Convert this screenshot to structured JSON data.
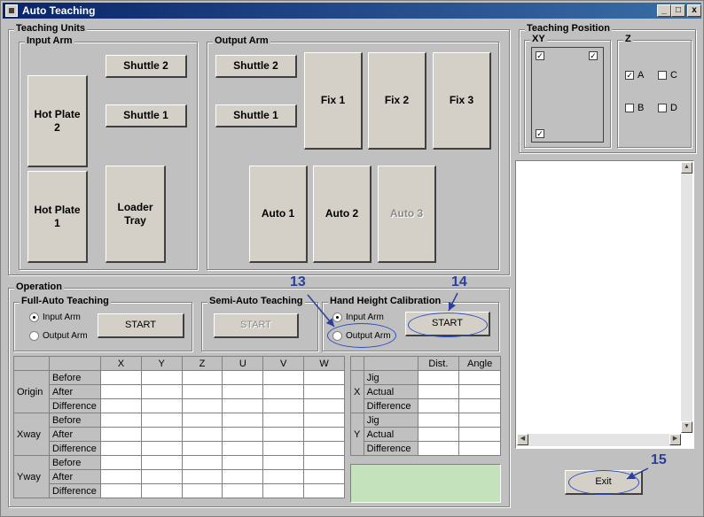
{
  "window": {
    "title": "Auto Teaching",
    "controls": {
      "minimize": "_",
      "maximize": "□",
      "close": "x"
    }
  },
  "teaching_units": {
    "label": "Teaching Units",
    "input_arm": {
      "label": "Input Arm",
      "hot_plate_2": "Hot Plate\n2",
      "hot_plate_1": "Hot Plate\n1",
      "shuttle_2": "Shuttle 2",
      "shuttle_1": "Shuttle 1",
      "loader_tray": "Loader\nTray"
    },
    "output_arm": {
      "label": "Output Arm",
      "shuttle_2": "Shuttle 2",
      "shuttle_1": "Shuttle 1",
      "fix_1": "Fix 1",
      "fix_2": "Fix 2",
      "fix_3": "Fix 3",
      "auto_1": "Auto 1",
      "auto_2": "Auto 2",
      "auto_3": "Auto 3"
    }
  },
  "teaching_position": {
    "label": "Teaching Position",
    "xy": {
      "label": "XY",
      "check": "✓"
    },
    "z": {
      "label": "Z",
      "a": "A",
      "b": "B",
      "c": "C",
      "d": "D",
      "check": "✓"
    }
  },
  "operation": {
    "label": "Operation",
    "full_auto": {
      "label": "Full-Auto Teaching",
      "input_arm": "Input Arm",
      "output_arm": "Output Arm",
      "start": "START"
    },
    "semi_auto": {
      "label": "Semi-Auto Teaching",
      "start": "START"
    },
    "hand_height": {
      "label": "Hand Height Calibration",
      "input_arm": "Input Arm",
      "output_arm": "Output Arm",
      "start": "START"
    }
  },
  "coord_table": {
    "columns": [
      "X",
      "Y",
      "Z",
      "U",
      "V",
      "W"
    ],
    "groups": [
      {
        "name": "Origin",
        "rows": [
          "Before",
          "After",
          "Difference"
        ]
      },
      {
        "name": "Xway",
        "rows": [
          "Before",
          "After",
          "Difference"
        ]
      },
      {
        "name": "Yway",
        "rows": [
          "Before",
          "After",
          "Difference"
        ]
      }
    ]
  },
  "dist_table": {
    "columns": [
      "Dist.",
      "Angle"
    ],
    "groups": [
      {
        "name": "X",
        "rows": [
          "Jig",
          "Actual",
          "Difference"
        ]
      },
      {
        "name": "Y",
        "rows": [
          "Jig",
          "Actual",
          "Difference"
        ]
      }
    ]
  },
  "exit_label": "Exit",
  "annotations": {
    "a13": "13",
    "a14": "14",
    "a15": "15"
  },
  "scroll": {
    "up": "▲",
    "down": "▼",
    "left": "◀",
    "right": "▶"
  },
  "colors": {
    "status_panel": "#c4e3bc",
    "annotation": "#2a3f9a"
  }
}
